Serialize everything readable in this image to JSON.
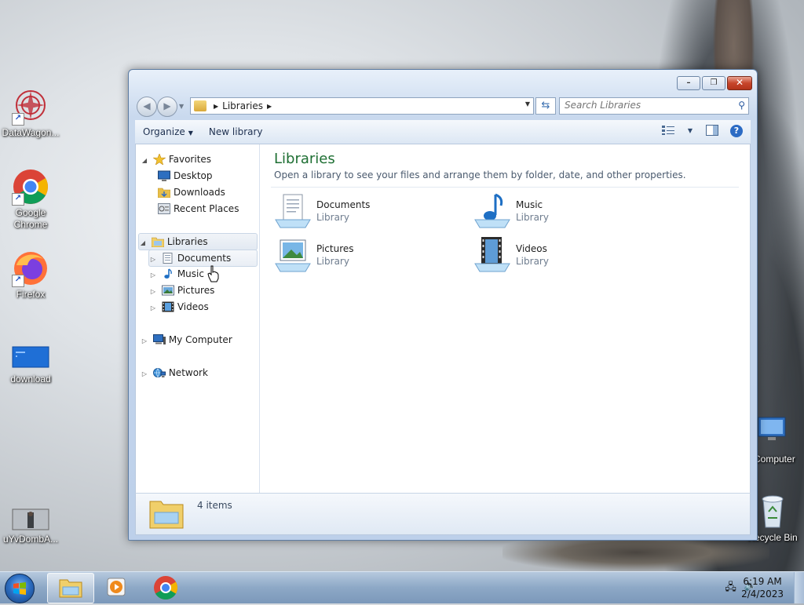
{
  "desktop": {
    "icons": [
      {
        "label": "DataWagon...",
        "icon": "datawagon-app-icon"
      },
      {
        "label": "Google Chrome",
        "icon": "chrome-icon"
      },
      {
        "label": "Firefox",
        "icon": "firefox-icon"
      },
      {
        "label": "download",
        "icon": "download-file-icon"
      },
      {
        "label": "uYvDombA...",
        "icon": "image-thumbnail-icon"
      },
      {
        "label": "Computer",
        "icon": "computer-icon"
      },
      {
        "label": "Recycle Bin",
        "icon": "recycle-bin-icon"
      }
    ]
  },
  "window": {
    "caption_buttons": {
      "minimize": "minimize-icon",
      "restore": "restore-icon",
      "close": "close-icon"
    },
    "address": {
      "crumbs": [
        "Libraries"
      ],
      "search_placeholder": "Search Libraries"
    },
    "toolbar": {
      "organize_label": "Organize",
      "new_library_label": "New library"
    },
    "nav_tree": {
      "favorites": {
        "label": "Favorites",
        "items": [
          "Desktop",
          "Downloads",
          "Recent Places"
        ]
      },
      "libraries": {
        "label": "Libraries",
        "items": [
          "Documents",
          "Music",
          "Pictures",
          "Videos"
        ]
      },
      "computer_label": "My Computer",
      "network_label": "Network"
    },
    "main": {
      "title": "Libraries",
      "subtitle": "Open a library to see your files and arrange them by folder, date, and other properties.",
      "libraries": [
        {
          "name": "Documents",
          "type": "Library",
          "icon": "documents-library-icon"
        },
        {
          "name": "Music",
          "type": "Library",
          "icon": "music-library-icon"
        },
        {
          "name": "Pictures",
          "type": "Library",
          "icon": "pictures-library-icon"
        },
        {
          "name": "Videos",
          "type": "Library",
          "icon": "videos-library-icon"
        }
      ]
    },
    "details": {
      "count_label": "4 items"
    }
  },
  "taskbar": {
    "time": "6:19 AM",
    "date": "2/4/2023"
  },
  "colors": {
    "title_green": "#1e6f33",
    "accent_blue": "#2c6bc4",
    "window_frame": "#bdd0ea"
  }
}
